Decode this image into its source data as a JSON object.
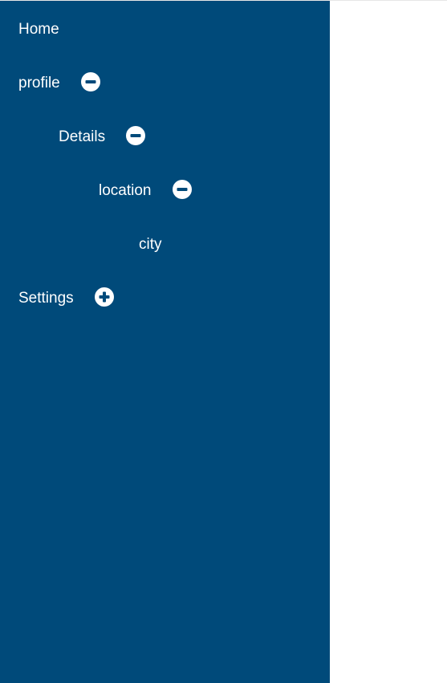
{
  "sidebar": {
    "background_color": "#004a7a",
    "text_color": "#ffffff",
    "items": [
      {
        "label": "Home",
        "expandable": false
      },
      {
        "label": "profile",
        "expandable": true,
        "state": "expanded",
        "icon": "minus-circle-icon"
      },
      {
        "label": "Details",
        "expandable": true,
        "state": "expanded",
        "icon": "minus-circle-icon"
      },
      {
        "label": "location",
        "expandable": true,
        "state": "expanded",
        "icon": "minus-circle-icon"
      },
      {
        "label": "city",
        "expandable": false
      },
      {
        "label": "Settings",
        "expandable": true,
        "state": "collapsed",
        "icon": "plus-circle-icon"
      }
    ]
  },
  "content": {
    "background_color": "#ffffff"
  }
}
